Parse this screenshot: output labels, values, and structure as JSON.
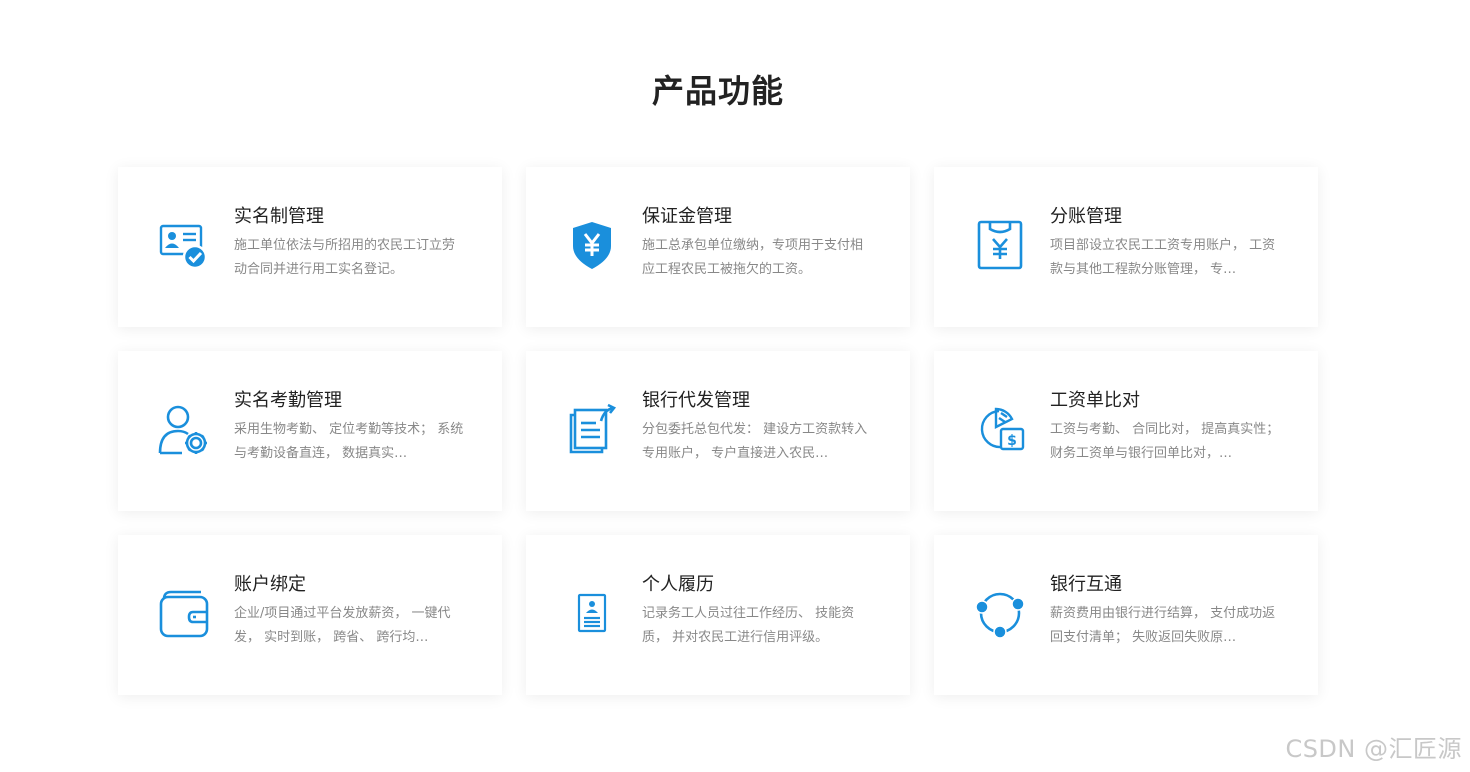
{
  "page": {
    "title": "产品功能"
  },
  "colors": {
    "accent": "#1a8fdc",
    "title": "#222222",
    "desc": "#888888"
  },
  "cards": [
    {
      "icon": "id-card-check-icon",
      "title": "实名制管理",
      "desc": "施工单位依法与所招用的农民工订立劳 动合同并进行用工实名登记。"
    },
    {
      "icon": "shield-yen-icon",
      "title": " 保证金管理",
      "desc": "施工总承包单位缴纳，专项用于支付相 应工程农民工被拖欠的工资。"
    },
    {
      "icon": "yen-document-icon",
      "title": "分账管理",
      "desc": "项目部设立农民工工资专用账户， 工资 款与其他工程款分账管理， 专…"
    },
    {
      "icon": "user-gear-icon",
      "title": "实名考勤管理",
      "desc": "采用生物考勤、 定位考勤等技术； 系统 与考勤设备直连， 数据真实…"
    },
    {
      "icon": "documents-share-icon",
      "title": "银行代发管理",
      "desc": "分包委托总包代发： 建设方工资款转入 专用账户， 专户直接进入农民…"
    },
    {
      "icon": "pie-chart-dollar-icon",
      "title": "工资单比对",
      "desc": "工资与考勤、 合同比对， 提高真实性； 财务工资单与银行回单比对，…"
    },
    {
      "icon": "wallet-icon",
      "title": "账户绑定",
      "desc": "企业/项目通过平台发放薪资， 一键代发， 实时到账， 跨省、 跨行均…"
    },
    {
      "icon": "resume-icon",
      "title": "个人履历",
      "desc": "记录务工人员过往工作经历、 技能资质， 并对农民工进行信用评级。"
    },
    {
      "icon": "network-nodes-icon",
      "title": "银行互通",
      "desc": "薪资费用由银行进行结算， 支付成功返 回支付清单； 失败返回失败原…"
    }
  ],
  "watermark": "CSDN @汇匠源"
}
